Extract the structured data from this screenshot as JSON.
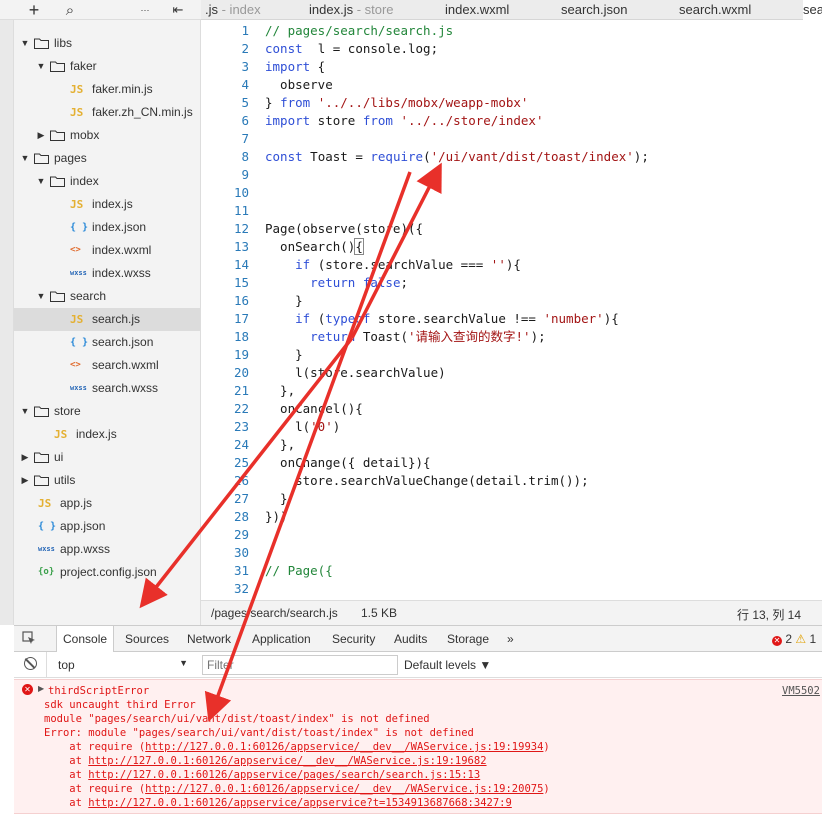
{
  "sidebar": {
    "toolbar": {
      "add": "+",
      "search": "⌕",
      "more": "···",
      "collapse": "⇤"
    },
    "tree": [
      {
        "label": "libs",
        "type": "folder",
        "open": true,
        "depth": 1
      },
      {
        "label": "faker",
        "type": "folder",
        "open": true,
        "depth": 2
      },
      {
        "label": "faker.min.js",
        "type": "js",
        "depth": 3
      },
      {
        "label": "faker.zh_CN.min.js",
        "type": "js",
        "depth": 3
      },
      {
        "label": "mobx",
        "type": "folder",
        "open": false,
        "depth": 2
      },
      {
        "label": "pages",
        "type": "folder",
        "open": true,
        "depth": 1
      },
      {
        "label": "index",
        "type": "folder",
        "open": true,
        "depth": 2
      },
      {
        "label": "index.js",
        "type": "js",
        "depth": 3
      },
      {
        "label": "index.json",
        "type": "json",
        "depth": 3
      },
      {
        "label": "index.wxml",
        "type": "wxml",
        "depth": 3
      },
      {
        "label": "index.wxss",
        "type": "wxss",
        "depth": 3
      },
      {
        "label": "search",
        "type": "folder",
        "open": true,
        "depth": 2
      },
      {
        "label": "search.js",
        "type": "js",
        "depth": 3,
        "selected": true
      },
      {
        "label": "search.json",
        "type": "json",
        "depth": 3
      },
      {
        "label": "search.wxml",
        "type": "wxml",
        "depth": 3
      },
      {
        "label": "search.wxss",
        "type": "wxss",
        "depth": 3
      },
      {
        "label": "store",
        "type": "folder",
        "open": true,
        "depth": 1
      },
      {
        "label": "index.js",
        "type": "js",
        "depth": 2
      },
      {
        "label": "ui",
        "type": "folder",
        "open": false,
        "depth": 1
      },
      {
        "label": "utils",
        "type": "folder",
        "open": false,
        "depth": 1
      },
      {
        "label": "app.js",
        "type": "js",
        "depth": 1
      },
      {
        "label": "app.json",
        "type": "json",
        "depth": 1
      },
      {
        "label": "app.wxss",
        "type": "wxss",
        "depth": 1
      },
      {
        "label": "project.config.json",
        "type": "config",
        "depth": 1
      }
    ]
  },
  "tabs": [
    {
      "name": ".js",
      "suffix": " - index"
    },
    {
      "name": "index.js",
      "suffix": " - store"
    },
    {
      "name": "index.wxml",
      "suffix": ""
    },
    {
      "name": "search.json",
      "suffix": ""
    },
    {
      "name": "search.wxml",
      "suffix": ""
    },
    {
      "name": "search.js",
      "suffix": "",
      "active": true
    }
  ],
  "editor": {
    "lines": [
      [
        [
          "cm",
          "// pages/search/search.js"
        ]
      ],
      [
        [
          "kw",
          "const"
        ],
        [
          "",
          "  l = console.log;"
        ]
      ],
      [
        [
          "kw",
          "import"
        ],
        [
          "",
          " {"
        ]
      ],
      [
        [
          "",
          "  observe"
        ]
      ],
      [
        [
          "",
          "} "
        ],
        [
          "kw",
          "from"
        ],
        [
          "",
          " "
        ],
        [
          "str",
          "'../../libs/mobx/weapp-mobx'"
        ]
      ],
      [
        [
          "kw",
          "import"
        ],
        [
          "",
          " store "
        ],
        [
          "kw",
          "from"
        ],
        [
          "",
          " "
        ],
        [
          "str",
          "'../../store/index'"
        ]
      ],
      [
        [
          "",
          ""
        ]
      ],
      [
        [
          "kw",
          "const"
        ],
        [
          "",
          " Toast = "
        ],
        [
          "kw",
          "require"
        ],
        [
          "",
          "("
        ],
        [
          "str",
          "'/ui/vant/dist/toast/index'"
        ],
        [
          "",
          "); "
        ]
      ],
      [
        [
          "",
          ""
        ]
      ],
      [
        [
          "",
          ""
        ]
      ],
      [
        [
          "",
          ""
        ]
      ],
      [
        [
          "",
          "Page(observe(store)({"
        ]
      ],
      [
        [
          "",
          "  onSearch()"
        ],
        [
          "cur",
          "{"
        ]
      ],
      [
        [
          "",
          "    "
        ],
        [
          "kw",
          "if"
        ],
        [
          "",
          " (store.searchValue === "
        ],
        [
          "str",
          "''"
        ],
        [
          "",
          ")"
        ],
        [
          "",
          "{"
        ]
      ],
      [
        [
          "",
          "      "
        ],
        [
          "kw",
          "return"
        ],
        [
          "",
          " "
        ],
        [
          "kw",
          "false"
        ],
        [
          "",
          ";"
        ]
      ],
      [
        [
          "",
          "    }"
        ]
      ],
      [
        [
          "",
          "    "
        ],
        [
          "kw",
          "if"
        ],
        [
          "",
          " ("
        ],
        [
          "kw",
          "typeof"
        ],
        [
          "",
          " store.searchValue !== "
        ],
        [
          "str",
          "'number'"
        ],
        [
          "",
          "){"
        ]
      ],
      [
        [
          "",
          "      "
        ],
        [
          "kw",
          "return"
        ],
        [
          "",
          " Toast("
        ],
        [
          "str",
          "'请输入查询的数字!'"
        ],
        [
          "",
          ");"
        ]
      ],
      [
        [
          "",
          "    }"
        ]
      ],
      [
        [
          "",
          "    l(store.searchValue)"
        ]
      ],
      [
        [
          "",
          "  },"
        ]
      ],
      [
        [
          "",
          "  onCancel(){"
        ]
      ],
      [
        [
          "",
          "    l("
        ],
        [
          "str",
          "'0'"
        ],
        [
          "",
          ")"
        ]
      ],
      [
        [
          "",
          "  },"
        ]
      ],
      [
        [
          "",
          "  onChange({ detail}){"
        ]
      ],
      [
        [
          "",
          "    store.searchValueChange(detail.trim());"
        ]
      ],
      [
        [
          "",
          "  }"
        ]
      ],
      [
        [
          "",
          "}))"
        ]
      ],
      [
        [
          "",
          ""
        ]
      ],
      [
        [
          "",
          ""
        ]
      ],
      [
        [
          "cm",
          "// Page({"
        ]
      ],
      [
        [
          "",
          ""
        ]
      ]
    ]
  },
  "status": {
    "path": "/pages/search/search.js",
    "size": "1.5 KB",
    "position": "行 13, 列 14"
  },
  "console": {
    "tabs": [
      "Console",
      "Sources",
      "Network",
      "Application",
      "Security",
      "Audits",
      "Storage",
      "»"
    ],
    "error_count": "2",
    "warn_count": "1",
    "context": "top",
    "filter_placeholder": "Filter",
    "levels": "Default levels ▼",
    "source_ref": "VM5502",
    "error_lines": [
      "thirdScriptError",
      "sdk uncaught third Error",
      "module \"pages/search/ui/vant/dist/toast/index\" is not defined",
      "Error: module \"pages/search/ui/vant/dist/toast/index\" is not defined"
    ],
    "stack": [
      {
        "prefix": "    at require (",
        "link": "http://127.0.0.1:60126/appservice/__dev__/WAService.js:19:19934",
        "suffix": ")"
      },
      {
        "prefix": "    at ",
        "link": "http://127.0.0.1:60126/appservice/__dev__/WAService.js:19:19682",
        "suffix": ""
      },
      {
        "prefix": "    at ",
        "link": "http://127.0.0.1:60126/appservice/pages/search/search.js:15:13",
        "suffix": ""
      },
      {
        "prefix": "    at require (",
        "link": "http://127.0.0.1:60126/appservice/__dev__/WAService.js:19:20075",
        "suffix": ")"
      },
      {
        "prefix": "    at ",
        "link": "http://127.0.0.1:60126/appservice/appservice?t=1534913687668:3427:9",
        "suffix": ""
      }
    ]
  },
  "colors": {
    "arrow": "#e8302a",
    "error": "#e01616",
    "keyword": "#2f4fd6",
    "string": "#a31515",
    "comment": "#22863a"
  }
}
